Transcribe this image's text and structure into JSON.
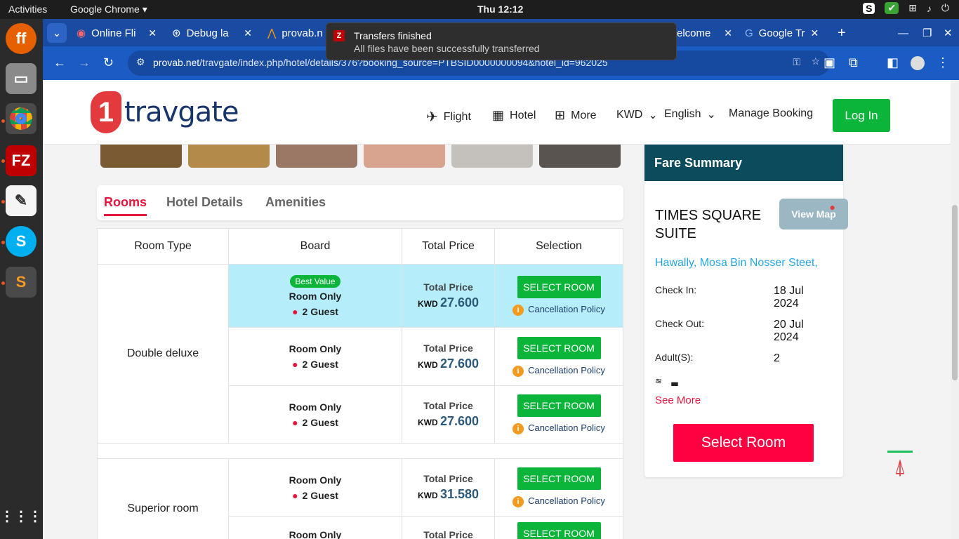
{
  "topbar": {
    "activities": "Activities",
    "app": "Google Chrome ▾",
    "clock": "Thu 12:12"
  },
  "tabs": [
    {
      "label": "Online Fli"
    },
    {
      "label": "Debug la"
    },
    {
      "label": "provab.n"
    },
    {
      "label": "elcome"
    },
    {
      "label": "Google Tr"
    }
  ],
  "notification": {
    "title": "Transfers finished",
    "body": "All files have been successfully transferred"
  },
  "address": {
    "host": "provab.net",
    "path": "/travgate/index.php/hotel/details/376?booking_source=PTBSID0000000094&hotel_id=962025"
  },
  "header": {
    "logo_mark": "1",
    "logo_word": "travgate",
    "flight": "Flight",
    "hotel": "Hotel",
    "more": "More",
    "currency": "KWD",
    "language": "English",
    "manage": "Manage Booking",
    "login": "Log In"
  },
  "room_tabs": {
    "rooms": "Rooms",
    "details": "Hotel Details",
    "amenities": "Amenities"
  },
  "table": {
    "headers": [
      "Room Type",
      "Board",
      "Total Price",
      "Selection"
    ],
    "best_value": "Best Value",
    "board": "Room Only",
    "guest": "2 Guest",
    "price_label": "Total Price",
    "currency": "KWD",
    "select": "SELECT ROOM",
    "policy": "Cancellation Policy",
    "groups": [
      {
        "type": "Double deluxe",
        "prices": [
          "27.600",
          "27.600",
          "27.600"
        ]
      },
      {
        "type": "Superior room",
        "prices": [
          "31.580"
        ]
      }
    ]
  },
  "fare": {
    "title": "Fare Summary",
    "hotel": "TIMES SQUARE SUITE",
    "map": "View Map",
    "address": "Hawally, Mosa Bin Nosser Steet,",
    "checkin_label": "Check In:",
    "checkin": "18 Jul 2024",
    "checkout_label": "Check Out:",
    "checkout": "20 Jul 2024",
    "adults_label": "Adult(S):",
    "adults": "2",
    "see_more": "See More",
    "select": "Select Room"
  },
  "colors": {
    "accent": "#e6163e",
    "green": "#0ab53a",
    "fare_head": "#0b4b5c"
  }
}
